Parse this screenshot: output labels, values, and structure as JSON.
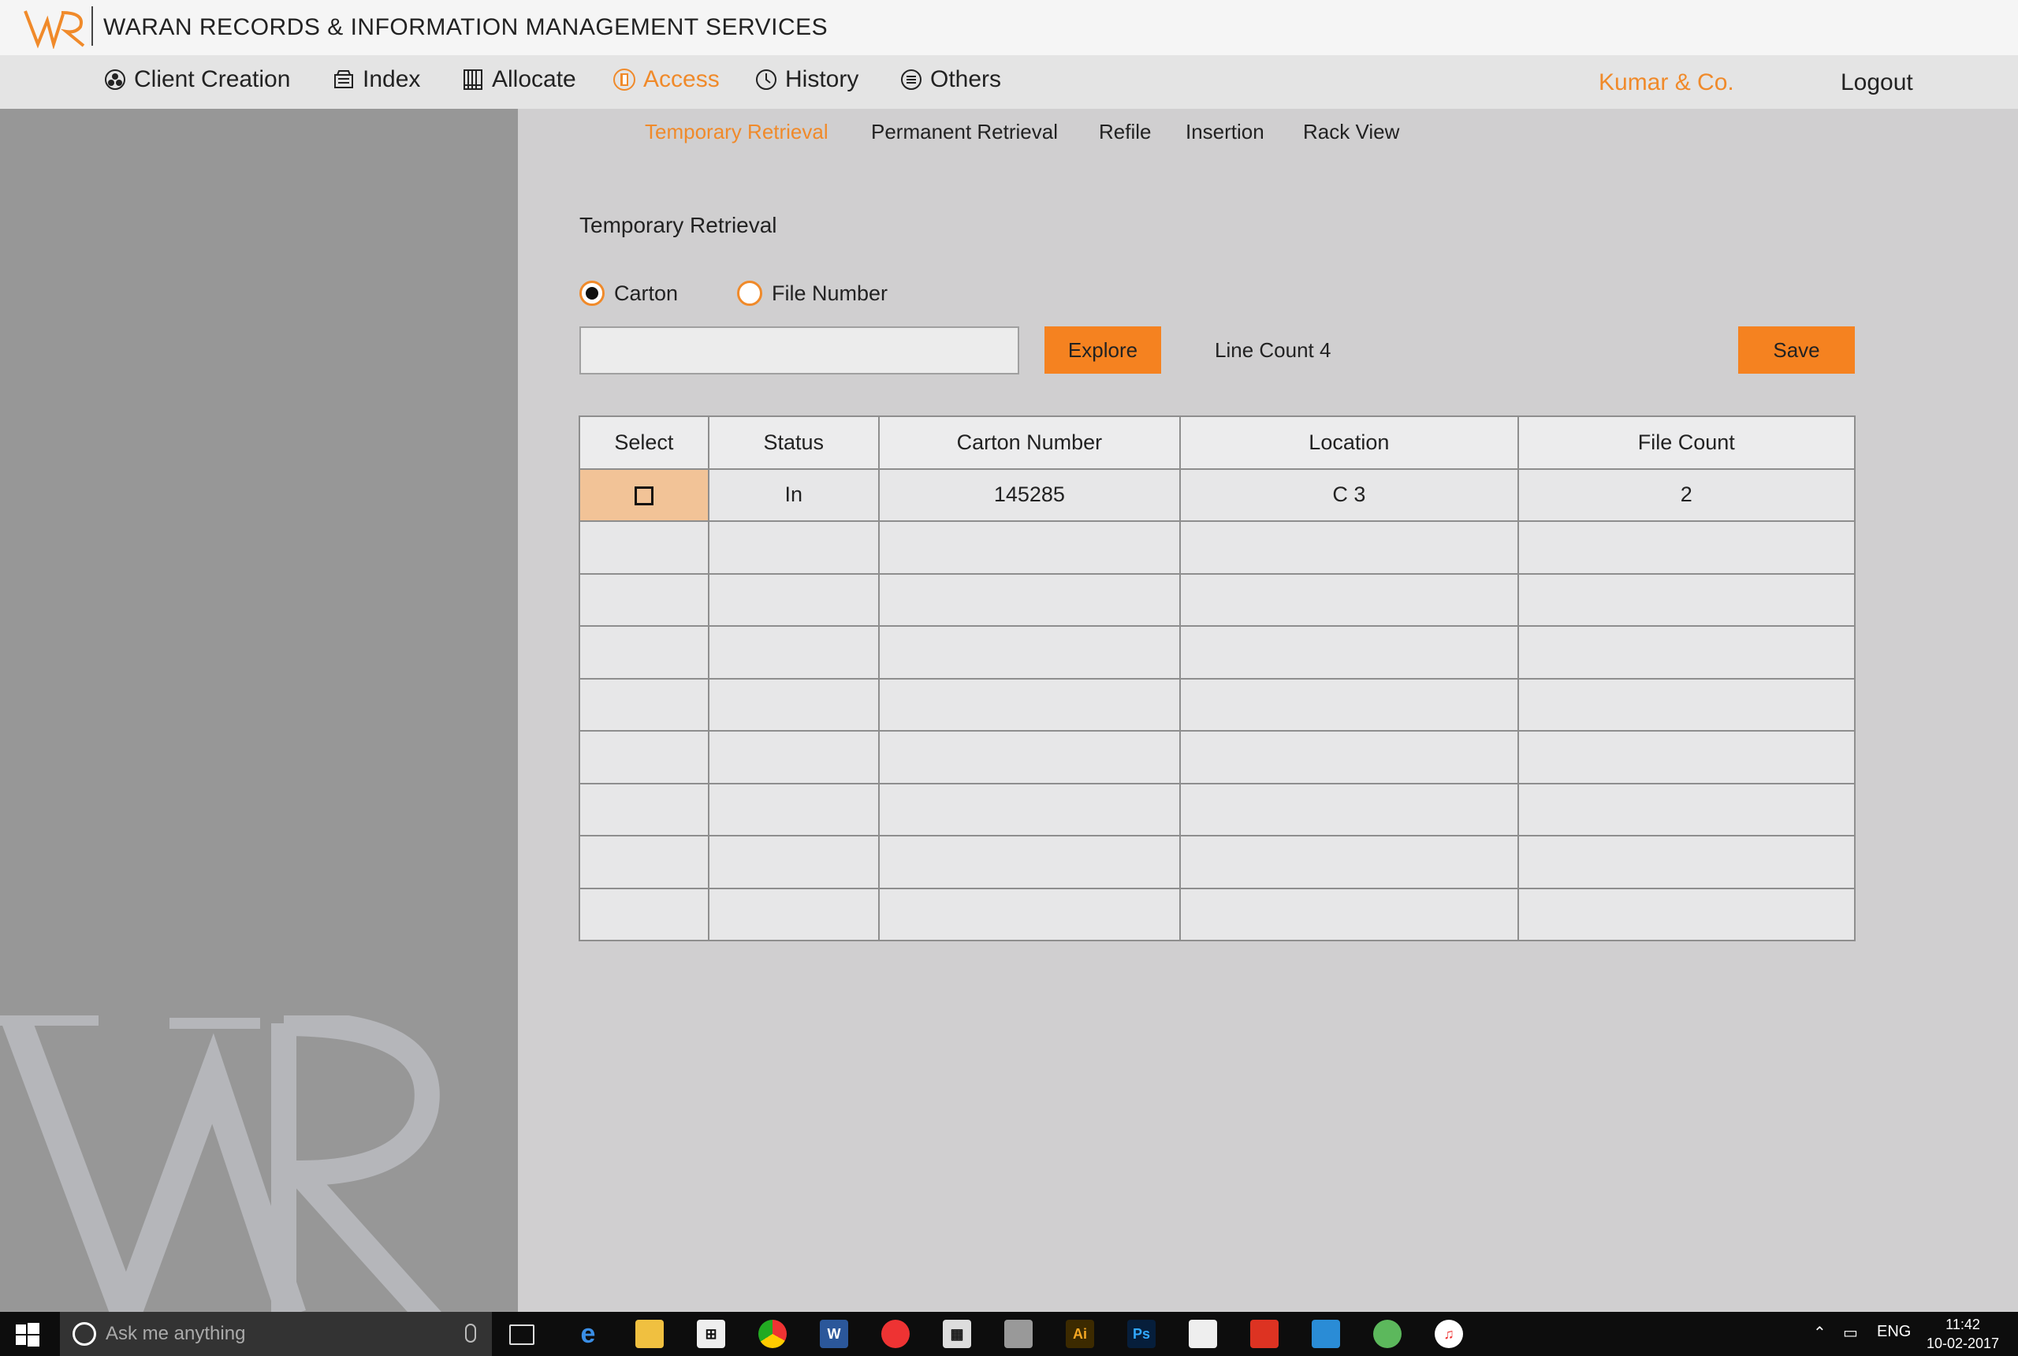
{
  "app": {
    "logo_text": "WR",
    "title": "WARAN RECORDS & INFORMATION MANAGEMENT SERVICES"
  },
  "nav": {
    "items": [
      {
        "label": "Client Creation",
        "icon": "client-icon"
      },
      {
        "label": "Index",
        "icon": "index-icon"
      },
      {
        "label": "Allocate",
        "icon": "allocate-icon"
      },
      {
        "label": "Access",
        "icon": "access-icon",
        "active": true
      },
      {
        "label": "History",
        "icon": "clock-icon"
      },
      {
        "label": "Others",
        "icon": "menu-icon"
      }
    ],
    "client_name": "Kumar & Co.",
    "logout_label": "Logout"
  },
  "subnav": {
    "items": [
      "Temporary Retrieval",
      "Permanent Retrieval",
      "Refile",
      "Insertion",
      "Rack View"
    ],
    "active": "Temporary Retrieval"
  },
  "form": {
    "section_title": "Temporary Retrieval",
    "radio_carton": "Carton",
    "radio_file_number": "File Number",
    "selected_radio": "Carton",
    "search_value": "",
    "explore_label": "Explore",
    "line_count_label": "Line Count 4",
    "save_label": "Save"
  },
  "table": {
    "headers": [
      "Select",
      "Status",
      "Carton Number",
      "Location",
      "File Count"
    ],
    "rows": [
      {
        "status": "In",
        "carton_number": "145285",
        "location": "C 3",
        "file_count": "2"
      }
    ]
  },
  "taskbar": {
    "search_placeholder": "Ask me anything",
    "language": "ENG",
    "time": "11:42",
    "date": "10-02-2017"
  },
  "colors": {
    "accent": "#f58220",
    "accent_text": "#f08a2a",
    "selected_cell": "#f2c397",
    "sidebar": "#979797",
    "main_bg": "#d0cfd0"
  }
}
